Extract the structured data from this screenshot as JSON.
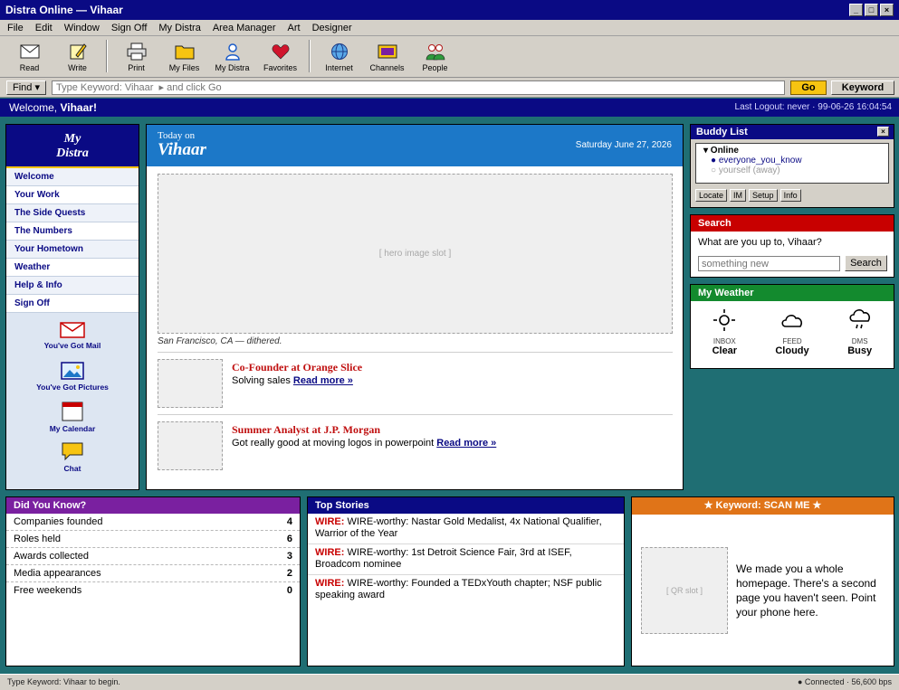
{
  "window": {
    "title": "Distra Online — Vihaar",
    "controls": [
      "_",
      "□",
      "×"
    ]
  },
  "menu": [
    "File",
    "Edit",
    "Window",
    "Sign Off",
    "My Distra",
    "Area Manager",
    "Art",
    "Designer"
  ],
  "toolbar": {
    "read": "Read",
    "write": "Write",
    "print": "Print",
    "my_files": "My Files",
    "my_distra": "My Distra",
    "favorites": "Favorites",
    "internet": "Internet",
    "channels": "Channels",
    "people": "People"
  },
  "findbar": {
    "find_label": "Find ▾",
    "keyword_placeholder": "Type Keyword: Vihaar  ▸ and click Go",
    "go_label": "Go",
    "keyword_label": "Keyword"
  },
  "welcome": {
    "prefix": "Welcome, ",
    "name": "Vihaar!",
    "last_logout": "Last Logout: never · 99-06-26 16:04:54"
  },
  "sidebar": {
    "title_line1": "My",
    "title_line2": "Distra",
    "items": [
      "Welcome",
      "Your Work",
      "The Side Quests",
      "The Numbers",
      "Your Hometown",
      "Weather",
      "Help & Info",
      "Sign Off"
    ],
    "quick": {
      "mail": "You've Got Mail",
      "pictures": "You've Got Pictures",
      "calendar": "My Calendar",
      "chat": "Chat"
    }
  },
  "center": {
    "today_on": "Today on",
    "name": "Vihaar",
    "date": "Saturday June 27, 2026",
    "hero_placeholder": "[ hero image slot ]",
    "hero_caption": "San Francisco, CA — dithered.",
    "stories": [
      {
        "title": "Co-Founder at Orange Slice",
        "desc": "Solving sales",
        "link": "Read more »"
      },
      {
        "title": "Summer Analyst at J.P. Morgan",
        "desc": "Got really good at moving logos in powerpoint",
        "link": "Read more »"
      }
    ]
  },
  "buddy": {
    "title": "Buddy List",
    "close": "×",
    "group": "▾ Online",
    "online": "● everyone_you_know",
    "away": "○ yourself (away)",
    "buttons": {
      "locate": "Locate",
      "im": "IM",
      "setup": "Setup",
      "info": "Info"
    }
  },
  "search": {
    "title": "Search",
    "question": "What are you up to, Vihaar?",
    "placeholder": "something new",
    "button": "Search"
  },
  "weather": {
    "title": "My Weather",
    "items": [
      {
        "source": "INBOX",
        "condition": "Clear",
        "icon": "sun-icon"
      },
      {
        "source": "FEED",
        "condition": "Cloudy",
        "icon": "cloud-icon"
      },
      {
        "source": "DMS",
        "condition": "Busy",
        "icon": "rain-icon"
      }
    ]
  },
  "did_you_know": {
    "title": "Did You Know?",
    "rows": [
      {
        "label": "Companies founded",
        "value": "4"
      },
      {
        "label": "Roles held",
        "value": "6"
      },
      {
        "label": "Awards collected",
        "value": "3"
      },
      {
        "label": "Media appearances",
        "value": "2"
      },
      {
        "label": "Free weekends",
        "value": "0"
      }
    ]
  },
  "top_stories": {
    "title": "Top Stories",
    "tag": "WIRE:",
    "items": [
      "WIRE-worthy: Nastar Gold Medalist, 4x National Qualifier, Warrior of the Year",
      "WIRE-worthy: 1st Detroit Science Fair, 3rd at ISEF, Broadcom nominee",
      "WIRE-worthy: Founded a TEDxYouth chapter; NSF public speaking award"
    ]
  },
  "keyword_panel": {
    "title": "★ Keyword: SCAN ME ★",
    "qr_placeholder": "[ QR slot ]",
    "text": "We made you a whole homepage. There's a second page you haven't seen. Point your phone here."
  },
  "status": {
    "left": "Type Keyword: Vihaar to begin.",
    "right": "● Connected · 56,600 bps"
  },
  "colors": {
    "title_bar": "#0a0a84",
    "desktop": "#1f6e73",
    "search_header": "#c80000",
    "weather_header": "#138a2e",
    "dyk_header": "#7a20a0",
    "keyword_header": "#e07418",
    "go_button": "#f7c411"
  }
}
